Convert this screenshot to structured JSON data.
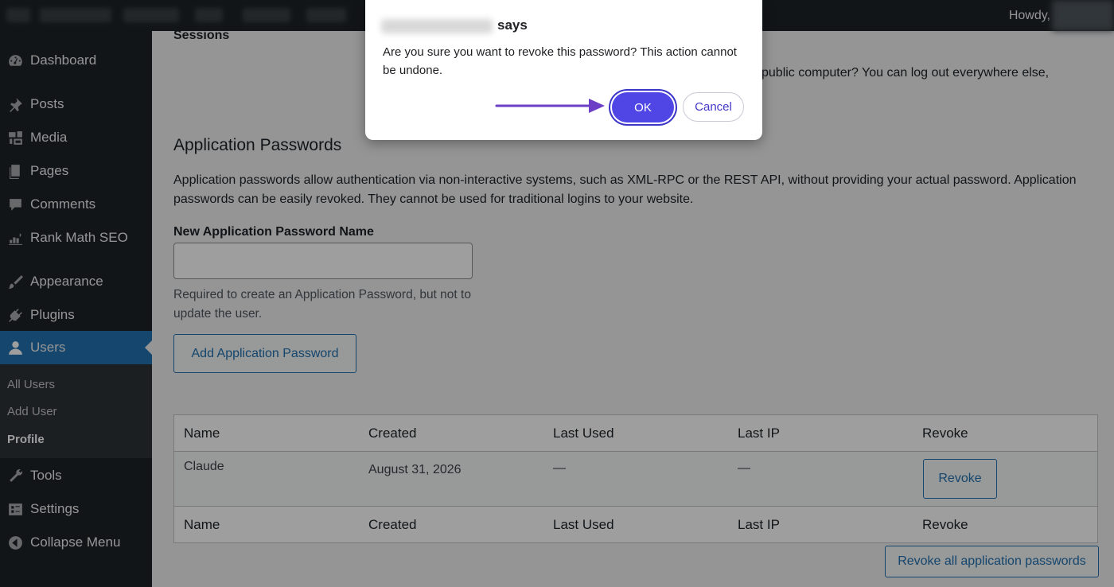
{
  "admin_bar": {
    "greeting": "Howdy,"
  },
  "sidebar": {
    "items": [
      {
        "label": "Dashboard",
        "icon": "dashboard-icon"
      },
      {
        "label": "Posts",
        "icon": "pin-icon"
      },
      {
        "label": "Media",
        "icon": "media-icon"
      },
      {
        "label": "Pages",
        "icon": "pages-icon"
      },
      {
        "label": "Comments",
        "icon": "comment-icon"
      },
      {
        "label": "Rank Math SEO",
        "icon": "chart-icon"
      },
      {
        "label": "Appearance",
        "icon": "brush-icon"
      },
      {
        "label": "Plugins",
        "icon": "plug-icon"
      },
      {
        "label": "Users",
        "icon": "user-icon"
      },
      {
        "label": "Tools",
        "icon": "wrench-icon"
      },
      {
        "label": "Settings",
        "icon": "settings-icon"
      },
      {
        "label": "Collapse Menu",
        "icon": "collapse-icon"
      }
    ],
    "submenu": [
      "All Users",
      "Add User",
      "Profile"
    ]
  },
  "main": {
    "sessions_heading": "Sessions",
    "sessions_text": "public computer? You can log out everywhere else,",
    "app_passwords": {
      "heading": "Application Passwords",
      "description": "Application passwords allow authentication via non-interactive systems, such as XML-RPC or the REST API, without providing your actual password. Application passwords can be easily revoked. They cannot be used for traditional logins to your website.",
      "field_label": "New Application Password Name",
      "input_value": "",
      "helper": "Required to create an Application Password, but not to update the user.",
      "add_button": "Add Application Password"
    },
    "table": {
      "columns": [
        "Name",
        "Created",
        "Last Used",
        "Last IP",
        "Revoke"
      ],
      "rows": [
        {
          "name": "Claude",
          "created": "August 31, 2026",
          "last_used": "—",
          "last_ip": "—",
          "revoke": "Revoke"
        }
      ]
    },
    "revoke_all": "Revoke all application passwords"
  },
  "dialog": {
    "says": "says",
    "message": "Are you sure you want to revoke this password? This action cannot be undone.",
    "ok": "OK",
    "cancel": "Cancel",
    "accent": "#4f46e5"
  }
}
